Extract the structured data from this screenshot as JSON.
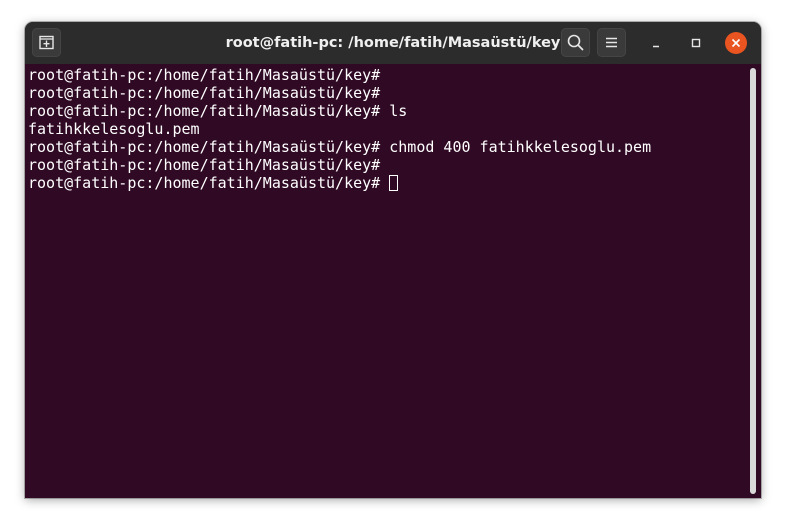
{
  "window": {
    "title": "root@fatih-pc: /home/fatih/Masaüstü/key"
  },
  "toolbar": {
    "new_tab_icon": "new-tab-icon",
    "search_icon": "search-icon",
    "menu_icon": "hamburger-menu-icon",
    "minimize_icon": "minimize-icon",
    "maximize_icon": "maximize-icon",
    "close_icon": "close-icon"
  },
  "terminal": {
    "lines": [
      "root@fatih-pc:/home/fatih/Masaüstü/key#",
      "root@fatih-pc:/home/fatih/Masaüstü/key#",
      "root@fatih-pc:/home/fatih/Masaüstü/key# ls",
      "fatihkkelesoglu.pem",
      "root@fatih-pc:/home/fatih/Masaüstü/key# chmod 400 fatihkkelesoglu.pem",
      "root@fatih-pc:/home/fatih/Masaüstü/key#",
      "root@fatih-pc:/home/fatih/Masaüstü/key#"
    ]
  },
  "colors": {
    "terminal_background": "#300a24",
    "titlebar_background": "#2c2c2c",
    "close_button": "#e95420",
    "text": "#ffffff"
  }
}
